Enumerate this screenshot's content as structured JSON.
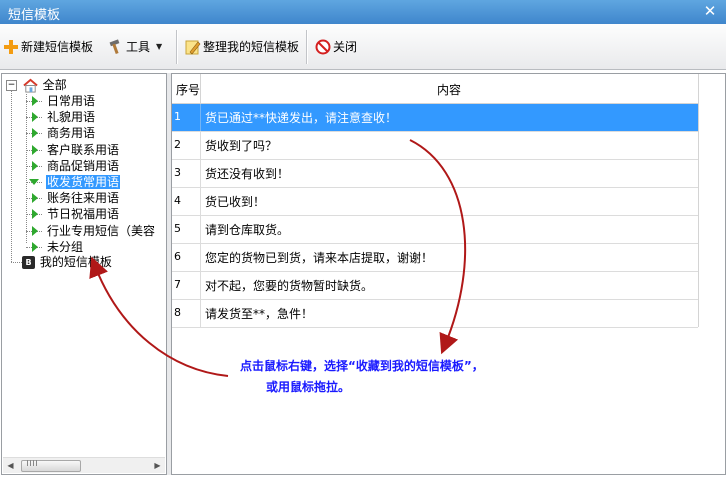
{
  "window": {
    "title": "短信模板",
    "close_glyph": "✕"
  },
  "toolbar": {
    "new_label": "新建短信模板",
    "tools_label": "工具",
    "organize_label": "整理我的短信模板",
    "close_label": "关闭"
  },
  "tree": {
    "root_label": "全部",
    "children": [
      "日常用语",
      "礼貌用语",
      "商务用语",
      "客户联系用语",
      "商品促销用语",
      "收发货常用语",
      "账务往来用语",
      "节日祝福用语",
      "行业专用短信（美容",
      "未分组"
    ],
    "selected_index": 5,
    "mine_label": "我的短信模板",
    "mine_badge": "B"
  },
  "grid": {
    "columns": [
      "序号",
      "内容"
    ],
    "rows": [
      {
        "no": "1",
        "content": "货已通过**快递发出，请注意查收！"
      },
      {
        "no": "2",
        "content": "货收到了吗？"
      },
      {
        "no": "3",
        "content": "货还没有收到！"
      },
      {
        "no": "4",
        "content": "货已收到！"
      },
      {
        "no": "5",
        "content": "请到仓库取货。"
      },
      {
        "no": "6",
        "content": "您定的货物已到货，请来本店提取，谢谢！"
      },
      {
        "no": "7",
        "content": "对不起，您要的货物暂时缺货。"
      },
      {
        "no": "8",
        "content": "请发货至**，急件！"
      }
    ],
    "selected_row": 0
  },
  "hint": {
    "line1": "点击鼠标右键，选择“收藏到我的短信模板”，",
    "line2": "或用鼠标拖拉。"
  },
  "colors": {
    "selection": "#3399ff",
    "hint_text": "#1a1aff",
    "arrow": "#b01818",
    "tree_arrow": "#2ea82e",
    "titlebar": "#4a90d6"
  }
}
